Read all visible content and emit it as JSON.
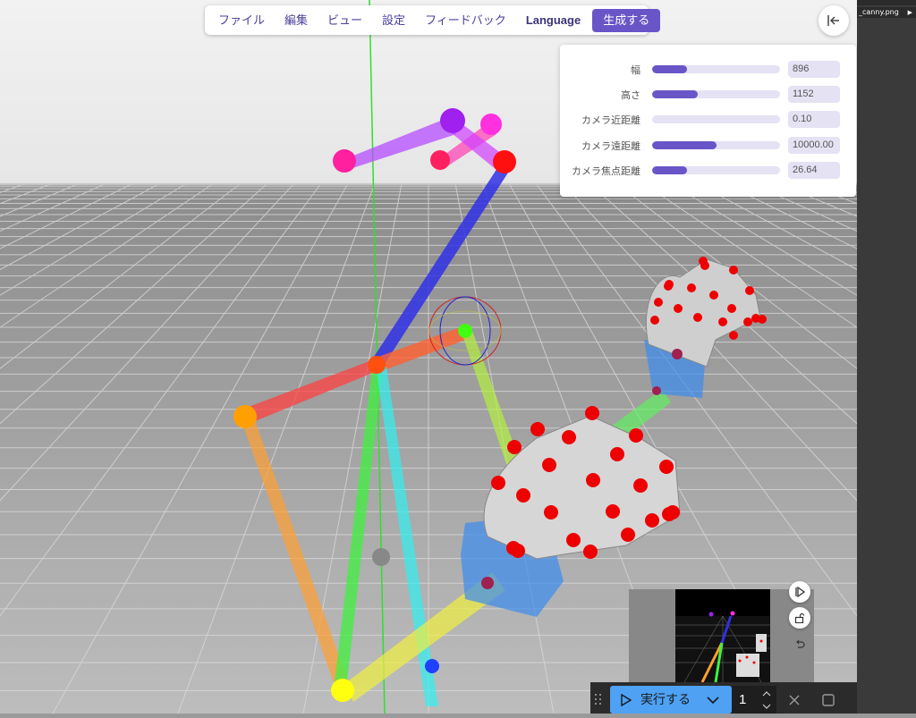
{
  "menu": {
    "items": [
      "ファイル",
      "編集",
      "ビュー",
      "設定",
      "フィードバック",
      "Language"
    ],
    "generate_label": "生成する"
  },
  "panel": {
    "rows": [
      {
        "label": "幅",
        "value": "896",
        "fill": 0.27
      },
      {
        "label": "高さ",
        "value": "1152",
        "fill": 0.36
      },
      {
        "label": "カメラ近距離",
        "value": "0.10",
        "fill": 0.0
      },
      {
        "label": "カメラ遠距離",
        "value": "10000.00",
        "fill": 0.5
      },
      {
        "label": "カメラ焦点距離",
        "value": "26.64",
        "fill": 0.27
      }
    ]
  },
  "files": [
    {
      "label": "_canny.png"
    }
  ],
  "runbar": {
    "run_label": "実行する",
    "count": "1"
  },
  "icons": {
    "collapse": "collapse-panel-icon",
    "play": "play-icon",
    "lock": "unlock-icon",
    "undo": "undo-icon",
    "close": "close-icon",
    "stop": "stop-icon"
  },
  "colors": {
    "accent": "#6a55c8",
    "run_button": "#4ea1f3"
  }
}
